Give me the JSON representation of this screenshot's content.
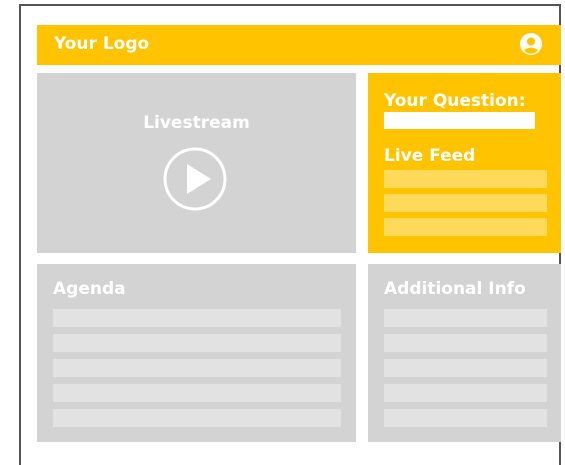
{
  "header": {
    "logo": "Your Logo",
    "user_icon": "user-circle-icon",
    "color": "#ffc300"
  },
  "livestream": {
    "title": "Livestream",
    "play_icon": "play-circle-icon"
  },
  "question_panel": {
    "title": "Your Question:",
    "input_value": "",
    "feed_title": "Live Feed",
    "feed_items": [
      "",
      "",
      ""
    ]
  },
  "agenda": {
    "title": "Agenda",
    "rows": [
      "",
      "",
      "",
      "",
      ""
    ]
  },
  "additional_info": {
    "title": "Additional Info",
    "rows": [
      "",
      "",
      "",
      "",
      ""
    ]
  },
  "colors": {
    "accent": "#ffc300",
    "panel": "#d3d3d3",
    "row": "#e2e2e2",
    "feed_row": "#ffd95a"
  }
}
